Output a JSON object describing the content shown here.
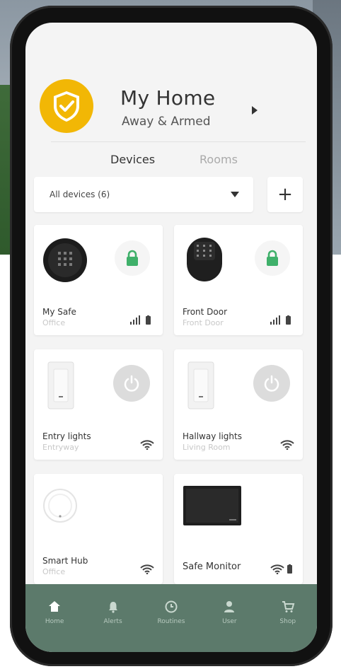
{
  "home": {
    "title": "My Home",
    "status": "Away & Armed"
  },
  "tabs": [
    {
      "label": "Devices",
      "active": true
    },
    {
      "label": "Rooms",
      "active": false
    }
  ],
  "filter": {
    "selected": "All devices (6)"
  },
  "add_label": "+",
  "devices": [
    {
      "name": "My Safe",
      "room": "Office",
      "type": "safe",
      "state": "locked",
      "signal": "cellular",
      "battery": true
    },
    {
      "name": "Front Door",
      "room": "Front Door",
      "type": "lock",
      "state": "locked",
      "signal": "cellular",
      "battery": true
    },
    {
      "name": "Entry lights",
      "room": "Entryway",
      "type": "switch",
      "state": "off",
      "signal": "wifi"
    },
    {
      "name": "Hallway lights",
      "room": "Living Room",
      "type": "switch",
      "state": "off",
      "signal": "wifi"
    },
    {
      "name": "Smart Hub",
      "room": "Office",
      "type": "hub",
      "signal": "wifi"
    },
    {
      "name": "Safe Monitor",
      "room": "",
      "type": "monitor",
      "signal": "wifi",
      "battery": true
    }
  ],
  "nav": [
    {
      "label": "Home",
      "icon": "home-icon"
    },
    {
      "label": "Alerts",
      "icon": "bell-icon"
    },
    {
      "label": "Routines",
      "icon": "clock-icon"
    },
    {
      "label": "User",
      "icon": "user-icon"
    },
    {
      "label": "Shop",
      "icon": "cart-icon"
    }
  ],
  "colors": {
    "accent": "#f2b705",
    "nav_bg": "#5c7a6b",
    "lock_green": "#3fb06a"
  }
}
